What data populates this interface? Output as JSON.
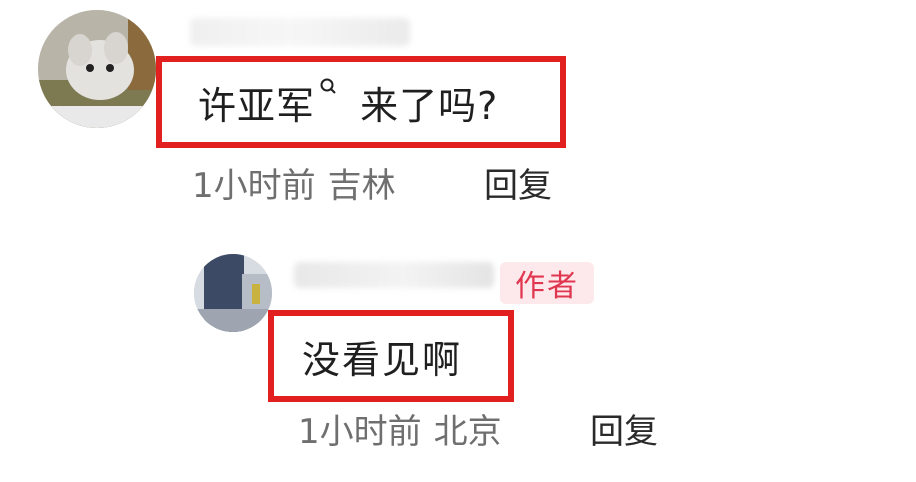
{
  "comment": {
    "text_prefix": "许亚军",
    "text_suffix": " 来了吗?",
    "time": "1小时前",
    "location": "吉林",
    "reply_label": "回复",
    "mention_icon": "search-icon"
  },
  "reply": {
    "author_badge": "作者",
    "text": "没看见啊",
    "time": "1小时前",
    "location": "北京",
    "reply_label": "回复"
  },
  "colors": {
    "highlight_border": "#e32020",
    "badge_text": "#e0364f",
    "badge_bg": "#fde9ec",
    "meta_text": "#6f6f6f"
  }
}
